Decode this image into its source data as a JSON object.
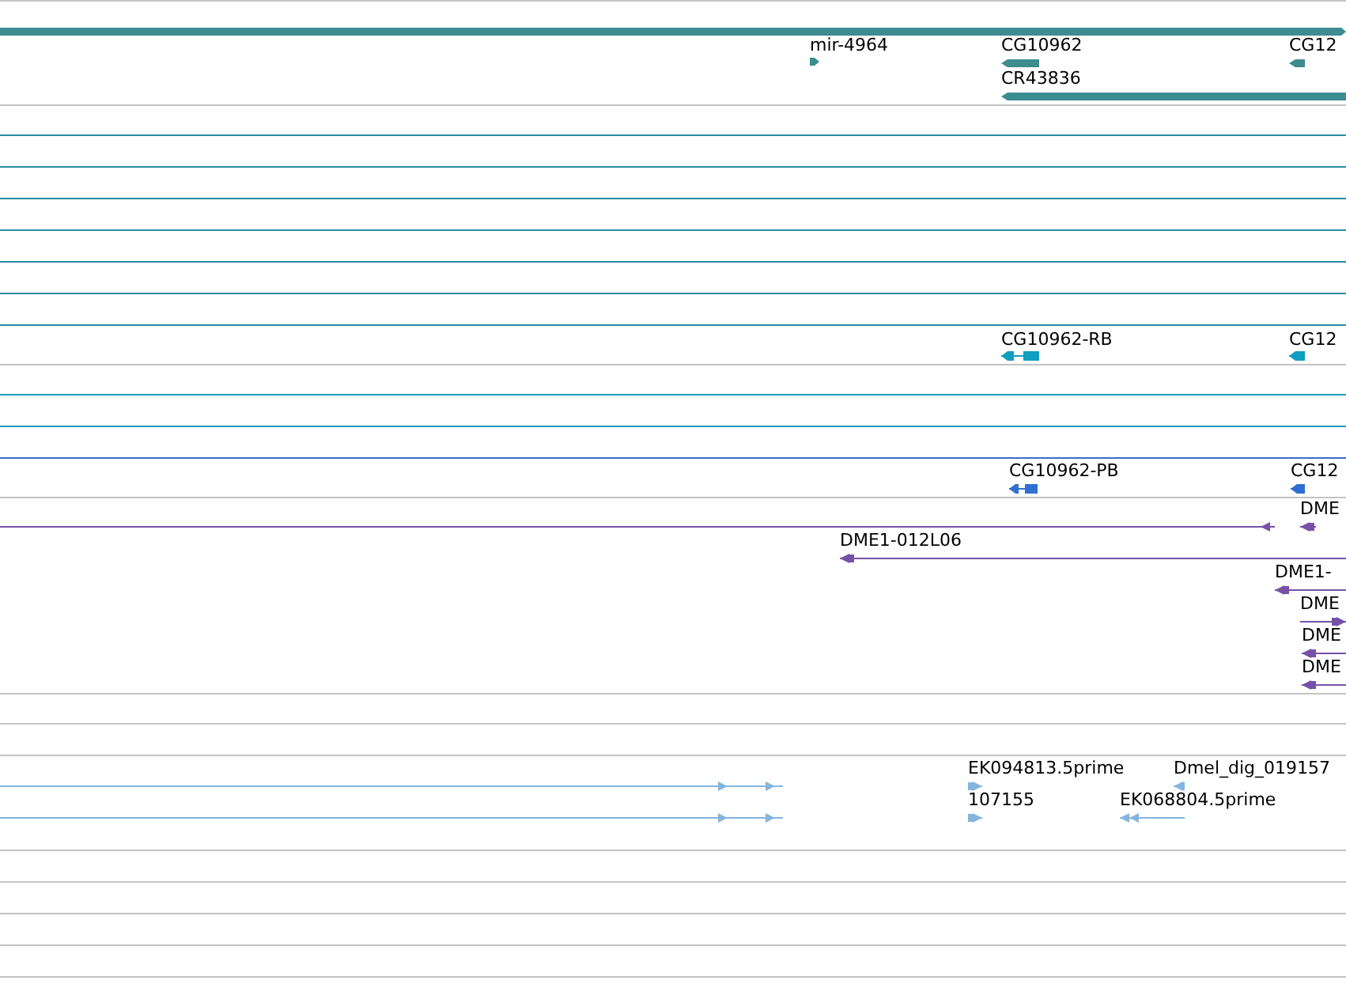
{
  "tracks": [
    {
      "kind": "gene",
      "color": "#3d8c8f",
      "features": [
        {
          "reverse": false
        },
        {
          "label": "mir-4964",
          "reverse": false
        },
        {
          "label": "CG10962",
          "reverse": true
        },
        {
          "label": "CG12",
          "reverse": true
        },
        {
          "label": "CR43836",
          "reverse": true
        }
      ]
    },
    {
      "kind": "transcript",
      "color": "#119fc0",
      "features": [
        {
          "label": "CG10962-RB",
          "reverse": true
        },
        {
          "label": "CG12",
          "reverse": true
        }
      ]
    },
    {
      "kind": "transcript",
      "color": "#2e6fd1",
      "features": [
        {
          "label": "CG10962-PB",
          "reverse": true
        },
        {
          "label": "CG12",
          "reverse": true
        }
      ]
    },
    {
      "kind": "clone",
      "color": "#7552a8",
      "features": [
        {
          "reverse": true
        },
        {
          "label": "DME",
          "reverse": true
        },
        {
          "label": "DME1-012L06",
          "reverse": true
        },
        {
          "label": "DME1-",
          "reverse": true
        },
        {
          "label": "DME",
          "reverse": false
        },
        {
          "label": "DME",
          "reverse": true
        },
        {
          "label": "DME",
          "reverse": true
        }
      ]
    },
    {
      "kind": "clone",
      "color": "#84b5dc",
      "features": [
        {
          "reverse": false
        },
        {
          "reverse": false
        },
        {
          "label": "EK094813.5prime",
          "reverse": false
        },
        {
          "label": "Dmel_dig_019157",
          "reverse": true
        },
        {
          "label": "107155",
          "reverse": false
        },
        {
          "label": "EK068804.5prime",
          "reverse": true
        }
      ]
    }
  ]
}
